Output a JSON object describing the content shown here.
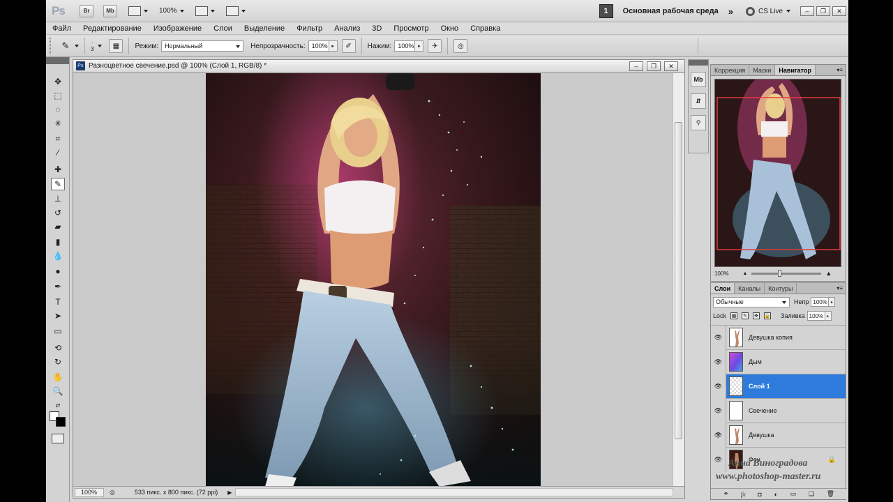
{
  "appbar": {
    "logo": "Ps",
    "bridge": "Br",
    "minibridge": "Mb",
    "zoom": "100%",
    "workspace_num": "1",
    "workspace": "Основная рабочая среда",
    "expand": "»",
    "cslive": "CS Live"
  },
  "menu": [
    "Файл",
    "Редактирование",
    "Изображение",
    "Слои",
    "Выделение",
    "Фильтр",
    "Анализ",
    "3D",
    "Просмотр",
    "Окно",
    "Справка"
  ],
  "options": {
    "brush_size": "3",
    "mode_label": "Режим:",
    "mode_value": "Нормальный",
    "opacity_label": "Непрозрачность:",
    "opacity_value": "100%",
    "flow_label": "Нажим:",
    "flow_value": "100%"
  },
  "document": {
    "title": "Разноцветное свечение.psd @ 100% (Слой 1, RGB/8) *",
    "zoom": "100%",
    "info": "533 пикс. x 800 пикс. (72 ppi)"
  },
  "panels": {
    "top_tabs": [
      "Коррекция",
      "Маски",
      "Навигатор"
    ],
    "nav_zoom": "100%",
    "layer_tabs": [
      "Слои",
      "Каналы",
      "Контуры"
    ],
    "blend": "Обычные",
    "opacity_label": "Непр",
    "opacity": "100%",
    "lock_label": "Lock",
    "fill_label": "Заливка",
    "fill": "100%"
  },
  "layers": [
    {
      "name": "Девушка копия",
      "selected": false,
      "thumb": "girl"
    },
    {
      "name": "Дым",
      "selected": false,
      "thumb": "smoke"
    },
    {
      "name": "Слой 1",
      "selected": true,
      "thumb": "empty"
    },
    {
      "name": "Свечение",
      "selected": false,
      "thumb": "empty"
    },
    {
      "name": "Девушка",
      "selected": false,
      "thumb": "girl"
    },
    {
      "name": "Фон",
      "selected": false,
      "thumb": "bg"
    }
  ],
  "watermark": {
    "line1": "Анна Виноградова",
    "line2": "www.photoshop-master.ru"
  },
  "colors": {
    "selection": "#2e7bdc",
    "navigator_frame": "#e23b3b"
  }
}
